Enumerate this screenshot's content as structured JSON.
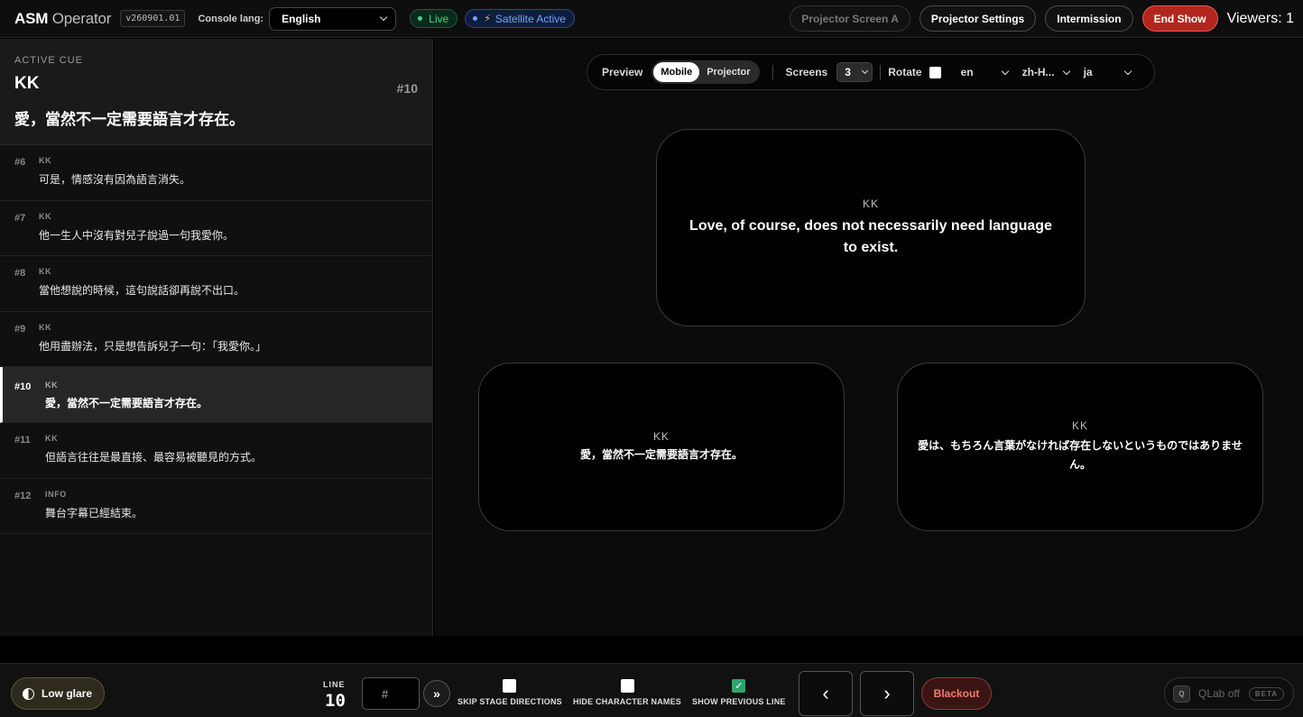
{
  "header": {
    "logo_bold": "ASM",
    "logo_light": "Operator",
    "version": "v260901.01",
    "console_lang_label": "Console lang:",
    "console_lang_value": "English",
    "live_label": "Live",
    "satellite_label": "Satellite Active",
    "projector_screen_label": "Projector Screen A",
    "projector_settings_label": "Projector Settings",
    "intermission_label": "Intermission",
    "end_show_label": "End Show",
    "viewers_label": "Viewers: 1"
  },
  "active_cue": {
    "label": "ACTIVE CUE",
    "speaker": "KK",
    "number": "#10",
    "text": "愛，當然不一定需要語言才存在。"
  },
  "cues": [
    {
      "number": "#6",
      "speaker": "KK",
      "text": "可是，情感沒有因為語言消失。"
    },
    {
      "number": "#7",
      "speaker": "KK",
      "text": "他一生人中沒有對兒子說過一句我愛你。"
    },
    {
      "number": "#8",
      "speaker": "KK",
      "text": "當他想說的時候，這句說話卻再說不出口。"
    },
    {
      "number": "#9",
      "speaker": "KK",
      "text": "他用盡辦法，只是想告訴兒子一句：「我愛你。」"
    },
    {
      "number": "#10",
      "speaker": "KK",
      "text": "愛，當然不一定需要語言才存在。"
    },
    {
      "number": "#11",
      "speaker": "KK",
      "text": "但語言往往是最直接、最容易被聽見的方式。"
    },
    {
      "number": "#12",
      "speaker": "INFO",
      "text": "舞台字幕已經結束。"
    }
  ],
  "preview_toolbar": {
    "preview_label": "Preview",
    "mode_mobile": "Mobile",
    "mode_projector": "Projector",
    "screens_label": "Screens",
    "screens_value": "3",
    "rotate_label": "Rotate",
    "lang1": "en",
    "lang2": "zh-H...",
    "lang3": "ja"
  },
  "screens": {
    "en": {
      "speaker": "KK",
      "text": "Love, of course, does not necessarily need language to exist."
    },
    "zh": {
      "speaker": "KK",
      "text": "愛，當然不一定需要語言才存在。"
    },
    "ja": {
      "speaker": "KK",
      "text": "愛は、もちろん言葉がなければ存在しないというものではありません。"
    }
  },
  "footer": {
    "low_glare_label": "Low glare",
    "line_label": "LINE",
    "line_value": "10",
    "goto_placeholder": "#",
    "go_symbol": "»",
    "skip_stage_label": "SKIP STAGE DIRECTIONS",
    "hide_names_label": "HIDE CHARACTER NAMES",
    "show_prev_label": "SHOW PREVIOUS LINE",
    "show_prev_checked": true,
    "prev_symbol": "‹",
    "next_symbol": "›",
    "blackout_label": "Blackout",
    "qlab_icon": "Q",
    "qlab_label": "QLab off",
    "beta_label": "BETA"
  }
}
